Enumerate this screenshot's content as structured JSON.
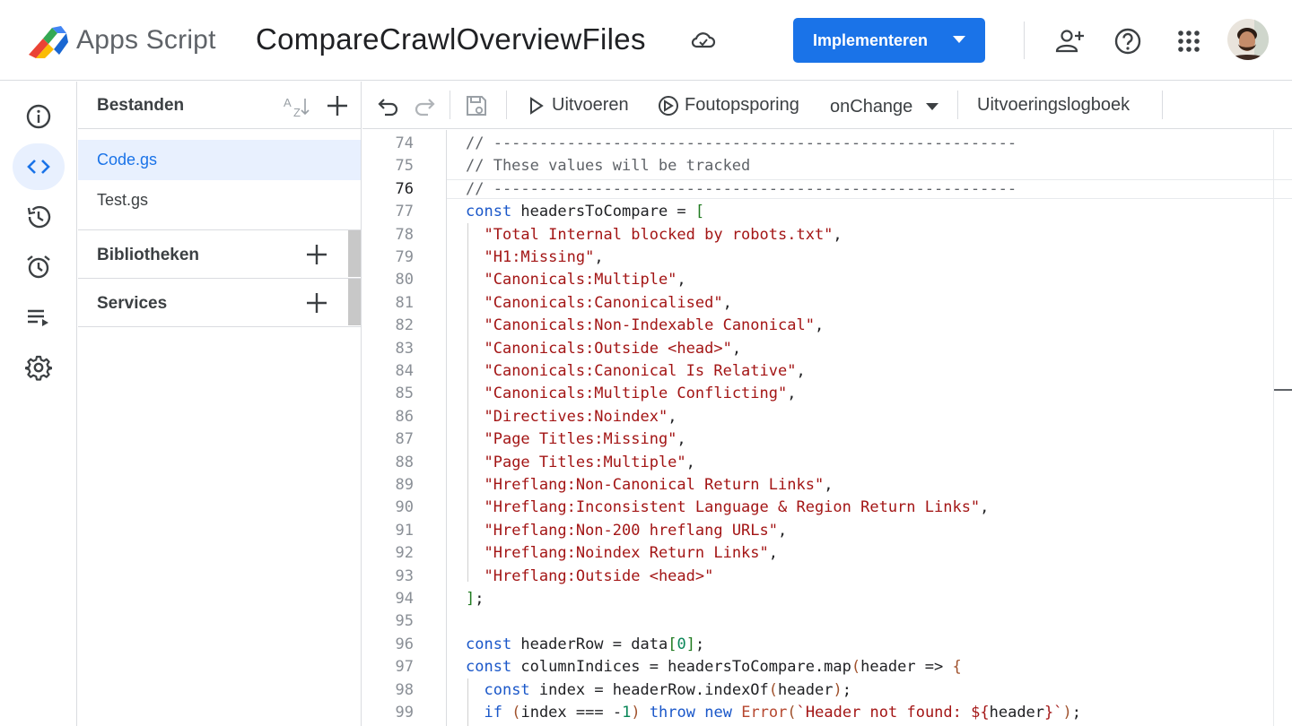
{
  "header": {
    "app_name": "Apps Script",
    "project_title": "CompareCrawlOverviewFiles",
    "deploy_label": "Implementeren"
  },
  "files_panel": {
    "title": "Bestanden",
    "files": [
      "Code.gs",
      "Test.gs"
    ],
    "active_file": "Code.gs",
    "sections": [
      "Bibliotheken",
      "Services"
    ]
  },
  "toolbar": {
    "run_label": "Uitvoeren",
    "debug_label": "Foutopsporing",
    "function_select": "onChange",
    "log_label": "Uitvoeringslogboek"
  },
  "editor": {
    "current_line": 76,
    "lines": [
      {
        "n": "74",
        "text": "// ---------------------------------------------------------"
      },
      {
        "n": "75",
        "text": "// These values will be tracked"
      },
      {
        "n": "76",
        "text": "// ---------------------------------------------------------"
      },
      {
        "n": "77",
        "text": "const headersToCompare = ["
      },
      {
        "n": "78",
        "text": "  \"Total Internal blocked by robots.txt\","
      },
      {
        "n": "79",
        "text": "  \"H1:Missing\","
      },
      {
        "n": "80",
        "text": "  \"Canonicals:Multiple\","
      },
      {
        "n": "81",
        "text": "  \"Canonicals:Canonicalised\","
      },
      {
        "n": "82",
        "text": "  \"Canonicals:Non-Indexable Canonical\","
      },
      {
        "n": "83",
        "text": "  \"Canonicals:Outside <head>\","
      },
      {
        "n": "84",
        "text": "  \"Canonicals:Canonical Is Relative\","
      },
      {
        "n": "85",
        "text": "  \"Canonicals:Multiple Conflicting\","
      },
      {
        "n": "86",
        "text": "  \"Directives:Noindex\","
      },
      {
        "n": "87",
        "text": "  \"Page Titles:Missing\","
      },
      {
        "n": "88",
        "text": "  \"Page Titles:Multiple\","
      },
      {
        "n": "89",
        "text": "  \"Hreflang:Non-Canonical Return Links\","
      },
      {
        "n": "90",
        "text": "  \"Hreflang:Inconsistent Language & Region Return Links\","
      },
      {
        "n": "91",
        "text": "  \"Hreflang:Non-200 hreflang URLs\","
      },
      {
        "n": "92",
        "text": "  \"Hreflang:Noindex Return Links\","
      },
      {
        "n": "93",
        "text": "  \"Hreflang:Outside <head>\""
      },
      {
        "n": "94",
        "text": "];"
      },
      {
        "n": "95",
        "text": ""
      },
      {
        "n": "96",
        "text": "const headerRow = data[0];"
      },
      {
        "n": "97",
        "text": "const columnIndices = headersToCompare.map(header => {"
      },
      {
        "n": "98",
        "text": "  const index = headerRow.indexOf(header);"
      },
      {
        "n": "99",
        "text": "  if (index === -1) throw new Error(`Header not found: ${header}`);"
      }
    ]
  },
  "colors": {
    "accent": "#1a73e8",
    "active_bg": "#e8f0fe",
    "string": "#a31515",
    "keyword": "#1a57c9",
    "comment": "#5f6368"
  },
  "icons": {
    "header": [
      "apps-script-logo",
      "cloud-saved-icon",
      "add-user-icon",
      "help-icon",
      "apps-grid-icon",
      "avatar"
    ],
    "rail": [
      "info-icon",
      "code-icon",
      "history-icon",
      "alarm-icon",
      "executions-icon",
      "settings-icon"
    ],
    "toolbar": [
      "undo-icon",
      "redo-icon",
      "save-icon",
      "play-icon",
      "debug-icon"
    ]
  }
}
